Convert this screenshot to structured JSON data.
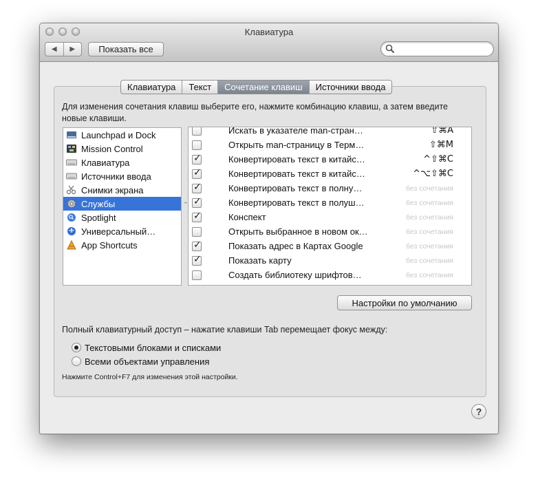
{
  "window": {
    "title": "Клавиатура"
  },
  "toolbar": {
    "back_icon": "◀",
    "forward_icon": "▶",
    "show_all_label": "Показать все",
    "search": {
      "value": "",
      "placeholder": ""
    }
  },
  "tabs": [
    {
      "label": "Клавиатура",
      "active": false
    },
    {
      "label": "Текст",
      "active": false
    },
    {
      "label": "Сочетание клавиш",
      "active": true
    },
    {
      "label": "Источники ввода",
      "active": false
    }
  ],
  "description": "Для изменения сочетания клавиш выберите его, нажмите комбинацию клавиш, а затем введите новые клавиши.",
  "sidebar": {
    "items": [
      {
        "label": "Launchpad и Dock",
        "icon": "dock-icon",
        "selected": false
      },
      {
        "label": "Mission Control",
        "icon": "mission-control-icon",
        "selected": false
      },
      {
        "label": "Клавиатура",
        "icon": "keyboard-icon",
        "selected": false
      },
      {
        "label": "Источники ввода",
        "icon": "keyboard-icon",
        "selected": false
      },
      {
        "label": "Снимки экрана",
        "icon": "scissors-icon",
        "selected": false
      },
      {
        "label": "Службы",
        "icon": "gear-icon",
        "selected": true
      },
      {
        "label": "Spotlight",
        "icon": "magnifier-icon",
        "selected": false
      },
      {
        "label": "Универсальный…",
        "icon": "accessibility-icon",
        "selected": false
      },
      {
        "label": "App Shortcuts",
        "icon": "app-shortcuts-icon",
        "selected": false
      }
    ]
  },
  "shortcuts": [
    {
      "checked": false,
      "label": "Искать в указателе man-стран…",
      "shortcut": "⇧⌘A",
      "none": false
    },
    {
      "checked": false,
      "label": "Открыть man-страницу в Терм…",
      "shortcut": "⇧⌘M",
      "none": false
    },
    {
      "checked": true,
      "label": "Конвертировать текст в китайс…",
      "shortcut": "^⇧⌘C",
      "none": false
    },
    {
      "checked": true,
      "label": "Конвертировать текст в китайс…",
      "shortcut": "^⌥⇧⌘C",
      "none": false
    },
    {
      "checked": true,
      "label": "Конвертировать текст в полну…",
      "shortcut": "без сочетания",
      "none": true
    },
    {
      "checked": true,
      "label": "Конвертировать текст в полуш…",
      "shortcut": "без сочетания",
      "none": true
    },
    {
      "checked": true,
      "label": "Конспект",
      "shortcut": "без сочетания",
      "none": true
    },
    {
      "checked": false,
      "label": "Открыть выбранное в новом ок…",
      "shortcut": "без сочетания",
      "none": true
    },
    {
      "checked": true,
      "label": "Показать адрес в Картах Google",
      "shortcut": "без сочетания",
      "none": true
    },
    {
      "checked": true,
      "label": "Показать карту",
      "shortcut": "без сочетания",
      "none": true
    },
    {
      "checked": false,
      "label": "Создать библиотеку шрифтов…",
      "shortcut": "без сочетания",
      "none": true
    }
  ],
  "defaults_button_label": "Настройки по умолчанию",
  "keyboard_access": {
    "label": "Полный клавиатурный доступ – нажатие клавиши Tab перемещает фокус между:",
    "options": [
      {
        "label": "Текстовыми блоками и списками",
        "selected": true
      },
      {
        "label": "Всеми объектами управления",
        "selected": false
      }
    ],
    "hint": "Нажмите Control+F7 для изменения этой настройки."
  },
  "help_label": "?"
}
